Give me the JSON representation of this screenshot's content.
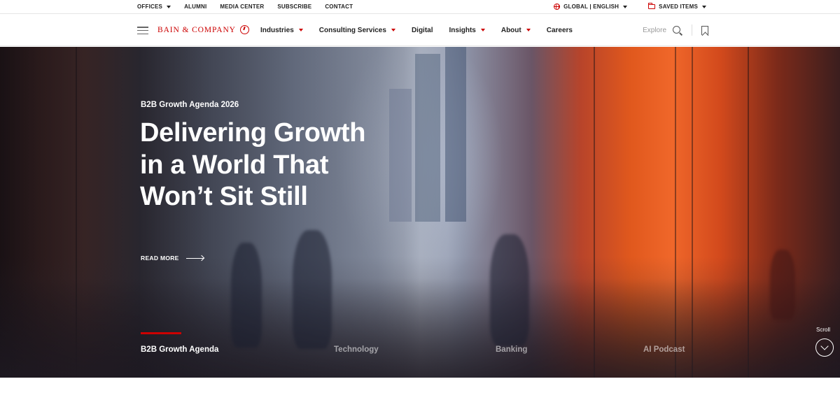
{
  "utility": {
    "left": [
      {
        "label": "OFFICES",
        "dropdown": true
      },
      {
        "label": "ALUMNI",
        "dropdown": false
      },
      {
        "label": "MEDIA CENTER",
        "dropdown": false
      },
      {
        "label": "SUBSCRIBE",
        "dropdown": false
      },
      {
        "label": "CONTACT",
        "dropdown": false
      }
    ],
    "language": "GLOBAL | ENGLISH",
    "saved_items": "SAVED ITEMS"
  },
  "brand": {
    "name": "BAIN & COMPANY",
    "accent": "#cc0000"
  },
  "nav": {
    "items": [
      {
        "label": "Industries",
        "dropdown": true
      },
      {
        "label": "Consulting Services",
        "dropdown": true
      },
      {
        "label": "Digital",
        "dropdown": false
      },
      {
        "label": "Insights",
        "dropdown": true
      },
      {
        "label": "About",
        "dropdown": true
      },
      {
        "label": "Careers",
        "dropdown": false
      }
    ],
    "explore": "Explore"
  },
  "hero": {
    "eyebrow": "B2B Growth Agenda 2026",
    "title": "Delivering Growth in a World That Won’t Sit Still",
    "read_more": "READ MORE",
    "tabs": [
      "B2B Growth Agenda",
      "Technology",
      "Banking",
      "AI Podcast"
    ],
    "active_tab": 0,
    "scroll": "Scroll"
  }
}
